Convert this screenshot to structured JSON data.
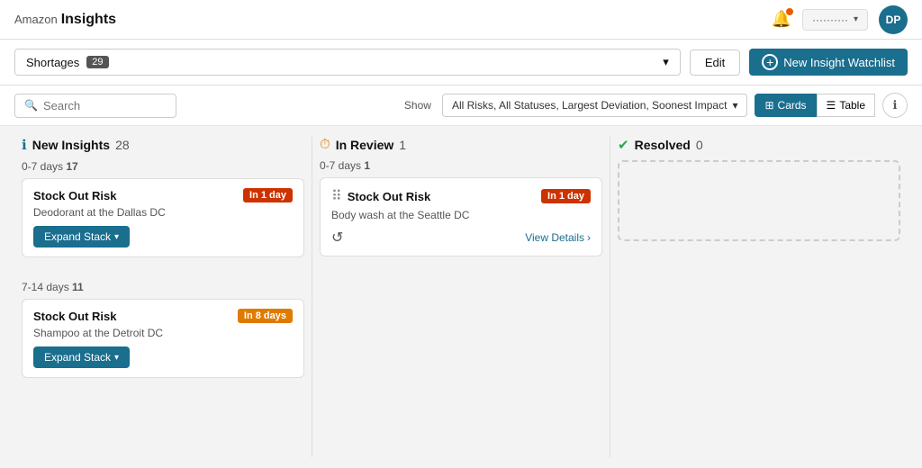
{
  "topNav": {
    "brand": "Amazon",
    "title": "Insights",
    "userLabel": "··········",
    "userInitials": "DP"
  },
  "toolbar": {
    "dropdownLabel": "Shortages",
    "dropdownCount": "29",
    "editLabel": "Edit",
    "newWatchlistLabel": "New Insight Watchlist"
  },
  "filterBar": {
    "searchPlaceholder": "Search",
    "showLabel": "Show",
    "filterValue": "All Risks, All Statuses, Largest Deviation, Soonest Impact",
    "cardsLabel": "Cards",
    "tableLabel": "Table"
  },
  "columns": [
    {
      "id": "new-insights",
      "icon": "ℹ",
      "iconColor": "#1a6e8e",
      "title": "New Insights",
      "count": "28",
      "sections": [
        {
          "rangeLabel": "0-7 days",
          "rangeCount": "17",
          "cards": [
            {
              "title": "Stock Out Risk",
              "badge": "In 1 day",
              "badgeColor": "red",
              "subtitle": "Deodorant at the Dallas DC",
              "hasExpand": true,
              "expandLabel": "Expand Stack",
              "hasDots": false
            }
          ]
        },
        {
          "rangeLabel": "7-14 days",
          "rangeCount": "11",
          "cards": [
            {
              "title": "Stock Out Risk",
              "badge": "In 8 days",
              "badgeColor": "orange",
              "subtitle": "Shampoo at the Detroit DC",
              "hasExpand": true,
              "expandLabel": "Expand Stack",
              "hasDots": false
            }
          ]
        }
      ]
    },
    {
      "id": "in-review",
      "icon": "🕐",
      "iconColor": "#e07b00",
      "title": "In Review",
      "count": "1",
      "sections": [
        {
          "rangeLabel": "0-7 days",
          "rangeCount": "1",
          "cards": [
            {
              "title": "Stock Out Risk",
              "badge": "In 1 day",
              "badgeColor": "red",
              "subtitle": "Body wash at the Seattle DC",
              "hasExpand": false,
              "hasDots": true,
              "viewDetailsLabel": "View Details"
            }
          ]
        }
      ]
    },
    {
      "id": "resolved",
      "icon": "✅",
      "iconColor": "#2ea44f",
      "title": "Resolved",
      "count": "0",
      "sections": []
    }
  ]
}
